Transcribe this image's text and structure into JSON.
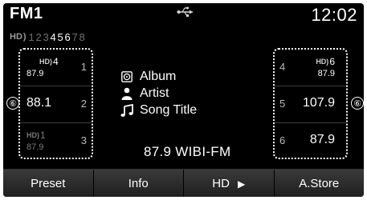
{
  "status": {
    "band": "FM1",
    "usb_icon": "usb-icon",
    "clock": "12:02"
  },
  "hd_channels": {
    "logo": "HD",
    "channels": [
      "1",
      "2",
      "3",
      "4",
      "5",
      "6",
      "7",
      "8"
    ],
    "active": [
      "4",
      "5",
      "6"
    ]
  },
  "presets_left": [
    {
      "number": "1",
      "freq": "87.9",
      "hd_channel": "4",
      "hd": true
    },
    {
      "number": "2",
      "freq": "88.1",
      "hd_channel": "",
      "hd": false
    },
    {
      "number": "3",
      "freq": "87.9",
      "hd_channel": "1",
      "hd": true
    }
  ],
  "presets_right": [
    {
      "number": "4",
      "freq": "87.9",
      "hd_channel": "6",
      "hd": true
    },
    {
      "number": "5",
      "freq": "107.9",
      "hd_channel": "",
      "hd": false
    },
    {
      "number": "6",
      "freq": "87.9",
      "hd_channel": "",
      "hd": false
    }
  ],
  "callouts": {
    "left": "⑥",
    "right": "⑥"
  },
  "now_playing": {
    "album": "Album",
    "artist": "Artist",
    "song": "Song Title",
    "station": "87.9 WIBI-FM"
  },
  "buttons": {
    "preset": "Preset",
    "info": "Info",
    "hd": "HD",
    "astore": "A.Store"
  }
}
